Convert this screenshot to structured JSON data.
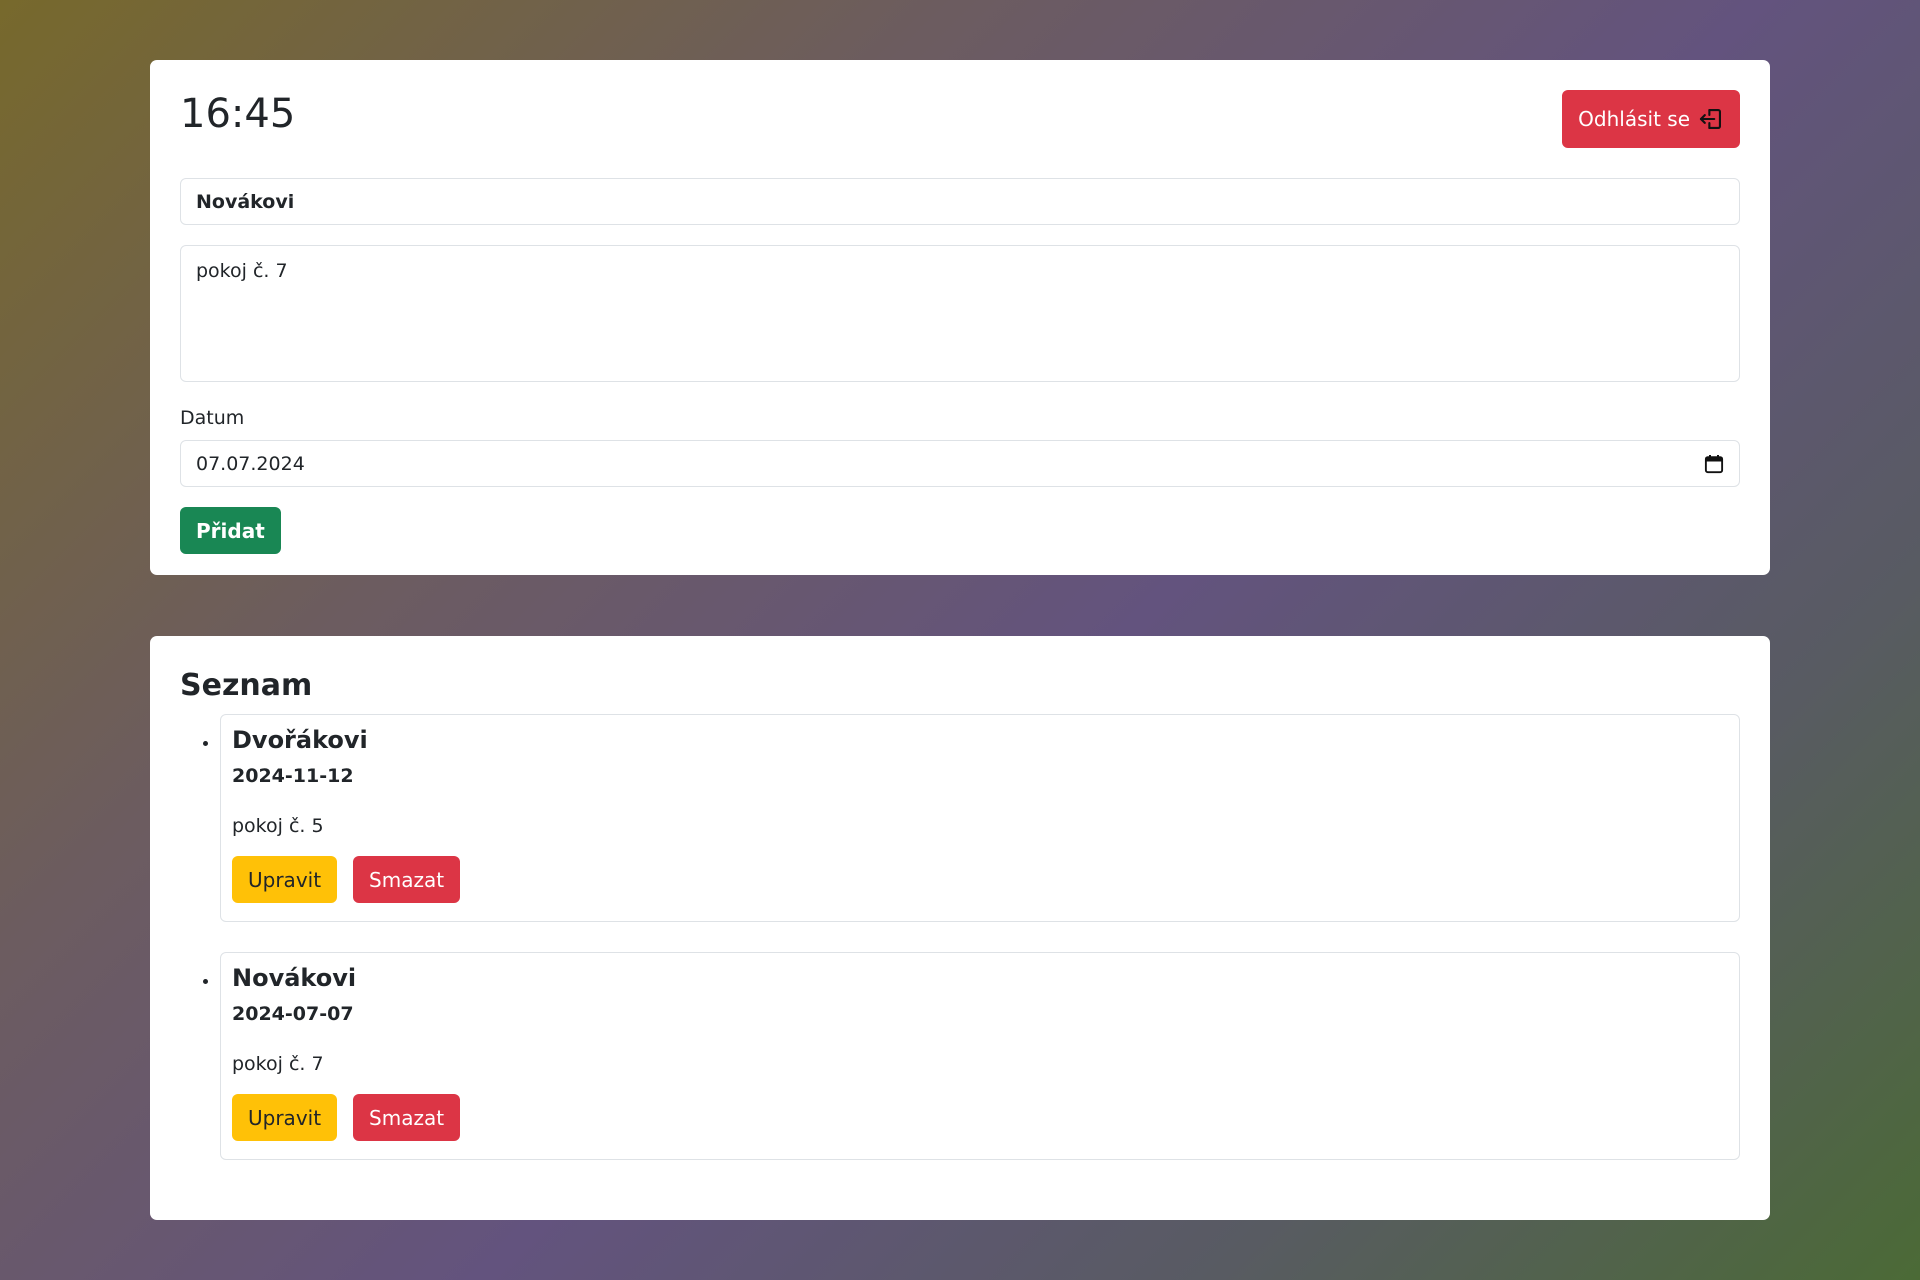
{
  "header": {
    "clock": "16:45",
    "logout_label": "Odhlásit se"
  },
  "form": {
    "name_value": "Novákovi",
    "note_value": "pokoj č. 7",
    "date_label": "Datum",
    "date_value": "07.07.2024",
    "add_label": "Přidat"
  },
  "list": {
    "title": "Seznam",
    "items": [
      {
        "name": "Dvořákovi",
        "date": "2024-11-12",
        "note": "pokoj č. 5",
        "edit_label": "Upravit",
        "delete_label": "Smazat"
      },
      {
        "name": "Novákovi",
        "date": "2024-07-07",
        "note": "pokoj č. 7",
        "edit_label": "Upravit",
        "delete_label": "Smazat"
      }
    ]
  },
  "colors": {
    "danger": "#dc3545",
    "success": "#198754",
    "warning": "#ffc107",
    "border": "#dee2e6"
  },
  "icons": {
    "logout": "box-arrow-left-icon",
    "calendar": "calendar-icon"
  }
}
